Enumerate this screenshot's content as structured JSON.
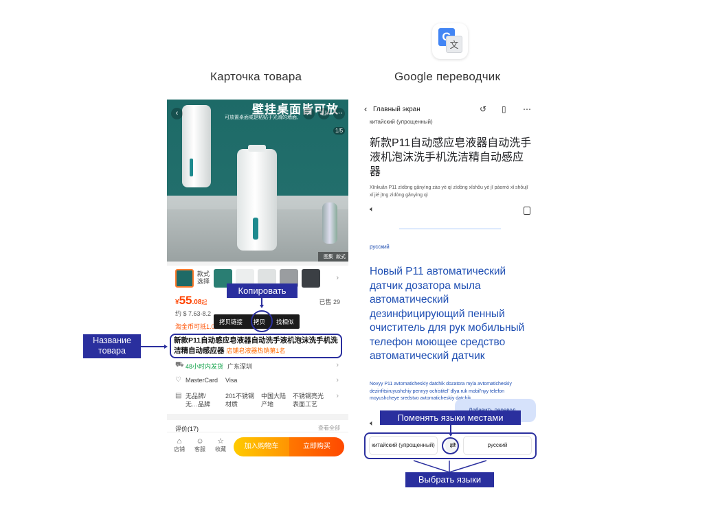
{
  "headings": {
    "left": "Карточка товара",
    "right": "Google переводчик"
  },
  "product": {
    "hero_title": "壁挂桌面皆可放",
    "hero_subtitle": "可放置桌面或是粘贴于光滑的墙面,",
    "counter": "1/5",
    "hero_tabs": [
      "图集",
      "款式"
    ],
    "style_label": "款式选择",
    "price": {
      "currency": "¥",
      "int": "55",
      "dec": ".08",
      "suffix": "起"
    },
    "sold": "已售 29",
    "usd": "约 $ 7.63-8.2",
    "coin": "淘金币可抵1.0",
    "context_menu": [
      "拷贝链接",
      "拷贝",
      "找相似"
    ],
    "title": "新款P11自动感应皂液器自动洗手液机泡沫洗手机洗洁精自动感应器",
    "rank": "店铺皂液器热销第1名",
    "shipping": {
      "time": "48小时内发货",
      "origin": "广东深圳"
    },
    "payment": {
      "card1": "MasterCard",
      "card2": "Visa"
    },
    "params": [
      "无品牌/无…品牌",
      "201不锈钢材质",
      "中国大陆产地",
      "不锈钢亮光表面工艺"
    ],
    "review": {
      "label": "评价(17)",
      "all": "查看全部"
    },
    "bottom": {
      "store": "店铺",
      "service": "客服",
      "fav": "收藏",
      "cart": "加入购物车",
      "buy": "立即购买"
    }
  },
  "translator": {
    "back_label": "Главный экран",
    "source_lang": "китайский (упрощенный)",
    "source_text": "新款P11自动感应皂液器自动洗手液机泡沫洗手机洗洁精自动感应器",
    "transliteration": "Xīnkuǎn P11 zìdòng gǎnyìng zào yè qì zìdòng xǐshǒu yè jī pàomò xǐ shǒujī xǐ jié jīng zìdòng gǎnyìng qì",
    "target_lang": "русский",
    "target_text": "Новый P11 автоматический датчик дозатора мыла автоматический дезинфицирующий пенный очиститель для рук мобильный телефон моющее средство автоматический датчик",
    "target_translit": "Novyy P11 avtomaticheskiy datchik dozatora myla avtomaticheskiy dezinfitsiruyushchiy pennyy ochistitel' dlya ruk mobil'nyy telefon moyushcheye sredstvo avtomaticheskiy datchik",
    "fab_label": "Добавить перевод",
    "lang_from": "китайский (упрощенный)",
    "lang_to": "русский"
  },
  "annotations": {
    "copy": "Копировать",
    "name": "Название товара",
    "swap": "Поменять языки местами",
    "pick": "Выбрать языки"
  },
  "colors": {
    "accent": "#2a2f9e",
    "price": "#ff4400",
    "translation": "#1f4fb3"
  },
  "icons": [
    "google-translate-icon",
    "back-icon",
    "history-icon",
    "bookmark-icon",
    "more-icon",
    "speaker-icon",
    "copy-icon",
    "swap-icon",
    "store-icon",
    "service-icon",
    "star-icon"
  ]
}
